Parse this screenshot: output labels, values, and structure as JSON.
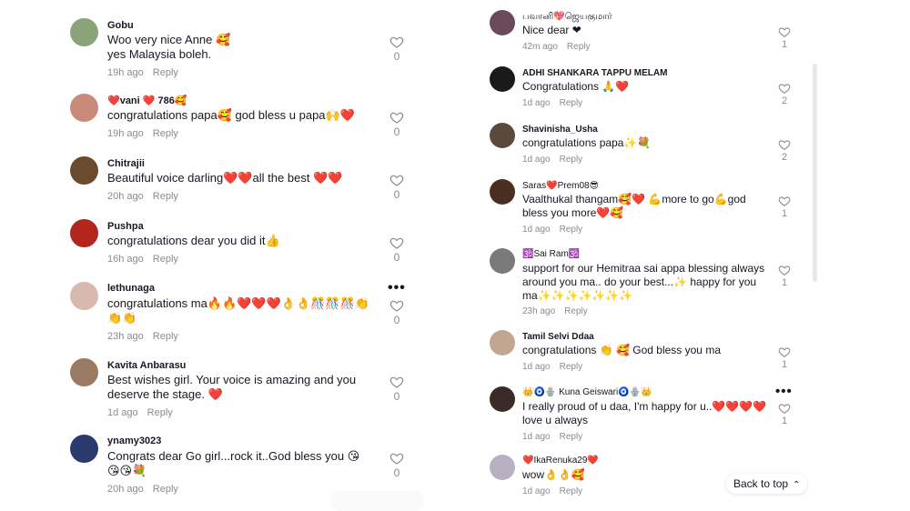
{
  "left_comments": [
    {
      "user": "Gobu",
      "text": "Woo very nice Anne 🥰\nyes Malaysia boleh.",
      "time": "19h ago",
      "reply": "Reply",
      "likes": "0",
      "avatar_color": "#8aa37b"
    },
    {
      "user": "❤️vani ❤️ 786🥰",
      "text": "congratulations papa🥰 god bless u papa🙌❤️",
      "time": "19h ago",
      "reply": "Reply",
      "likes": "0",
      "avatar_color": "#c98a7a"
    },
    {
      "user": "Chitrajii",
      "text": "Beautiful voice darling❤️❤️all the best ❤️❤️",
      "time": "20h ago",
      "reply": "Reply",
      "likes": "0",
      "avatar_color": "#6b4a2e"
    },
    {
      "user": "Pushpa",
      "text": "congratulations dear you did it👍",
      "time": "16h ago",
      "reply": "Reply",
      "likes": "0",
      "avatar_color": "#b3261e"
    },
    {
      "user": "lethunaga",
      "text": "congratulations ma🔥🔥❤️❤️❤️👌👌🎊🎊🎊👏\n👏👏",
      "time": "23h ago",
      "reply": "Reply",
      "likes": "0",
      "avatar_color": "#d9b8b0"
    },
    {
      "user": "Kavita Anbarasu",
      "text": "Best wishes girl. Your voice is amazing and you\ndeserve the stage. ❤️",
      "time": "1d ago",
      "reply": "Reply",
      "likes": "0",
      "avatar_color": "#9a7a62"
    },
    {
      "user": "ynamy3023",
      "text": "Congrats dear Go girl...rock it..God bless you 😘\n😘😘💐",
      "time": "20h ago",
      "reply": "Reply",
      "likes": "0",
      "avatar_color": "#2b3a6e"
    }
  ],
  "right_comments": [
    {
      "user": "பவானி💖ஜெயகுமார்",
      "text": "Nice dear ❤",
      "time": "42m ago",
      "reply": "Reply",
      "likes": "1",
      "avatar_color": "#6b4a5e"
    },
    {
      "user": "ADHI SHANKARA TAPPU MELAM",
      "text": "Congratulations 🙏❤️",
      "time": "1d ago",
      "reply": "Reply",
      "likes": "2",
      "avatar_color": "#1a1a1a"
    },
    {
      "user": "Shavinisha_Usha",
      "text": "congratulations papa✨💐",
      "time": "1d ago",
      "reply": "Reply",
      "likes": "2",
      "avatar_color": "#5a4a3e"
    },
    {
      "user": "Saras❤️Prem08😎",
      "text": "Vaalthukal thangam🥰❤️ 💪more to go💪god\nbless you more❤️🥰",
      "time": "1d ago",
      "reply": "Reply",
      "likes": "1",
      "avatar_color": "#4a2e22"
    },
    {
      "user": "🕉️Sai Ram🕉️",
      "text": "support for our Hemitraa sai appa blessing always\naround you ma.. do your best...✨ happy for you\nma✨✨✨✨✨✨✨",
      "time": "23h ago",
      "reply": "Reply",
      "likes": "1",
      "avatar_color": "#7a7a7a"
    },
    {
      "user": "Tamil Selvi Ddaa",
      "text": "congratulations 👏 🥰 God bless you ma",
      "time": "1d ago",
      "reply": "Reply",
      "likes": "1",
      "avatar_color": "#c4a590"
    },
    {
      "user": "👑🧿🪬 Kuna Geiswari🧿🪬👑",
      "text": "I really proud of u daa, I'm happy for u..❤️❤️❤️❤️\nlove u always",
      "time": "1d ago",
      "reply": "Reply",
      "likes": "1",
      "avatar_color": "#3b2a2a"
    },
    {
      "user": "❤️IkaRenuka29❤️",
      "text": "wow👌👌🥰",
      "time": "1d ago",
      "reply": "Reply",
      "likes": "",
      "avatar_color": "#b8b0c0"
    }
  ],
  "back_to_top": "Back to top",
  "more_label": "•••"
}
